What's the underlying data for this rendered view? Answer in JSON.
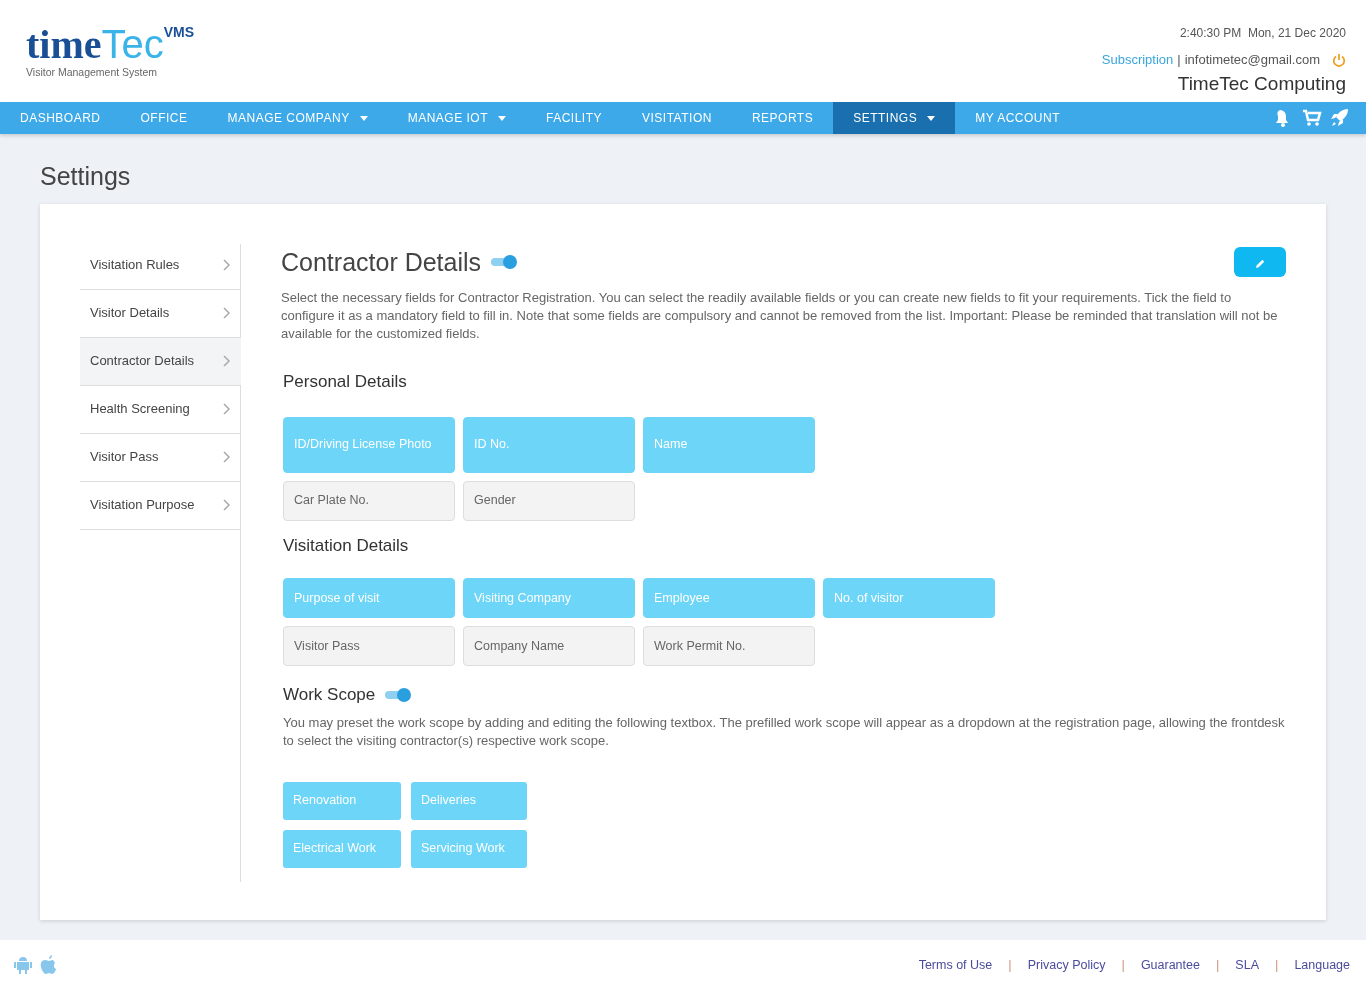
{
  "logo": {
    "word_a": "time",
    "word_b": "Tec",
    "badge": "VMS",
    "tagline": "Visitor Management System"
  },
  "header": {
    "datetime": "2:40:30 PM  Mon, 21 Dec 2020",
    "subscription": "Subscription",
    "separator": "|",
    "email": "infotimetec@gmail.com",
    "company": "TimeTec Computing"
  },
  "nav": [
    {
      "label": "DASHBOARD",
      "selected": false,
      "dropdown": false
    },
    {
      "label": "OFFICE",
      "selected": false,
      "dropdown": false
    },
    {
      "label": "MANAGE COMPANY",
      "selected": false,
      "dropdown": true
    },
    {
      "label": "MANAGE IOT",
      "selected": false,
      "dropdown": true
    },
    {
      "label": "FACILITY",
      "selected": false,
      "dropdown": false
    },
    {
      "label": "VISITATION",
      "selected": false,
      "dropdown": false
    },
    {
      "label": "REPORTS",
      "selected": false,
      "dropdown": false
    },
    {
      "label": "SETTINGS",
      "selected": true,
      "dropdown": true
    },
    {
      "label": "MY ACCOUNT",
      "selected": false,
      "dropdown": false
    }
  ],
  "page_title": "Settings",
  "sidebar": [
    {
      "label": "Visitation Rules",
      "selected": false
    },
    {
      "label": "Visitor Details",
      "selected": false
    },
    {
      "label": "Contractor Details",
      "selected": true
    },
    {
      "label": "Health Screening",
      "selected": false
    },
    {
      "label": "Visitor Pass",
      "selected": false
    },
    {
      "label": "Visitation Purpose",
      "selected": false
    }
  ],
  "section": {
    "title": "Contractor Details",
    "on": true,
    "description": "Select the necessary fields for Contractor Registration. You can select the readily available fields or you can create new fields to fit your requirements. Tick the field to configure it as a mandatory field to fill in. Note that some fields are compulsory and cannot be removed from the list. Important: Please be reminded that translation will not be available for the customized fields.",
    "groups": [
      {
        "title": "Personal Details",
        "rows": [
          [
            {
              "label": "ID/Driving License Photo",
              "selected": true
            },
            {
              "label": "ID No.",
              "selected": true
            },
            {
              "label": "Name",
              "selected": true
            }
          ],
          [
            {
              "label": "Car Plate No.",
              "selected": false
            },
            {
              "label": "Gender",
              "selected": false
            }
          ]
        ]
      },
      {
        "title": "Visitation Details",
        "rows": [
          [
            {
              "label": "Purpose of visit",
              "selected": true
            },
            {
              "label": "Visiting Company",
              "selected": true
            },
            {
              "label": "Employee",
              "selected": true
            },
            {
              "label": "No. of visitor",
              "selected": true
            }
          ],
          [
            {
              "label": "Visitor Pass",
              "selected": false
            },
            {
              "label": "Company Name",
              "selected": false
            },
            {
              "label": "Work Permit No.",
              "selected": false
            }
          ]
        ]
      }
    ]
  },
  "work_scope": {
    "title": "Work Scope",
    "on": true,
    "description": "You may preset the work scope by adding and editing the following textbox. The prefilled work scope will appear as a dropdown at the registration page, allowing the frontdesk to select the visiting contractor(s) respective work scope.",
    "items": [
      "Renovation",
      "Deliveries",
      "Electrical Work",
      "Servicing Work"
    ]
  },
  "footer": {
    "links": [
      "Terms of Use",
      "Privacy Policy",
      "Guarantee",
      "SLA",
      "Language"
    ],
    "separator": "|"
  }
}
